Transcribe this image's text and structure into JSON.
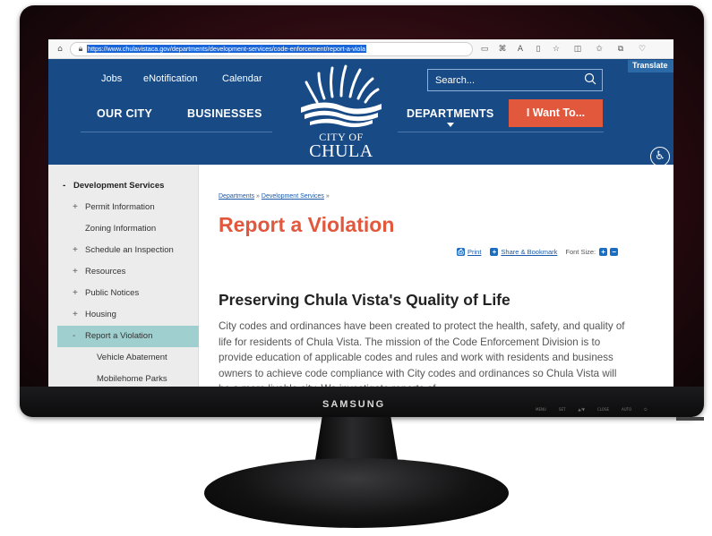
{
  "monitor": {
    "brand": "SAMSUNG",
    "controls": [
      "MENU",
      "SET",
      "▲/▼",
      "CLOSE",
      "AUTO",
      "⏻"
    ]
  },
  "browser": {
    "url": "https://www.chulavistaca.gov/departments/development-services/code-enforcement/report-a-viola"
  },
  "header": {
    "utility_links": [
      "Jobs",
      "eNotification",
      "Calendar"
    ],
    "search_placeholder": "Search...",
    "translate": "Translate",
    "nav": [
      "OUR CITY",
      "BUSINESSES",
      "DEPARTMENTS"
    ],
    "cta": "I Want To...",
    "logo_city": "CITY OF",
    "logo_name": "CHULA VISTA"
  },
  "sidebar": {
    "items": [
      {
        "sign": "-",
        "label": "Development Services"
      },
      {
        "sign": "+",
        "label": "Permit Information"
      },
      {
        "sign": "",
        "label": "Zoning Information"
      },
      {
        "sign": "+",
        "label": "Schedule an Inspection"
      },
      {
        "sign": "+",
        "label": "Resources"
      },
      {
        "sign": "+",
        "label": "Public Notices"
      },
      {
        "sign": "+",
        "label": "Housing"
      },
      {
        "sign": "-",
        "label": "Report a Violation"
      },
      {
        "sign": "",
        "label": "Vehicle Abatement"
      },
      {
        "sign": "",
        "label": "Mobilehome Parks"
      }
    ]
  },
  "main": {
    "breadcrumb": [
      "Departments",
      "Development Services"
    ],
    "breadcrumb_sep": "»",
    "title": "Report a Violation",
    "tools": {
      "print": "Print",
      "share": "Share & Bookmark",
      "font_size": "Font Size:"
    },
    "section_title": "Preserving Chula Vista's Quality of Life",
    "body": "City codes and ordinances have been created to protect the health, safety, and quality of life for residents of Chula Vista. The mission of the Code Enforcement Division is to provide education of applicable codes and rules and work with residents and business owners to achieve code compliance with City codes and ordinances so Chula Vista will be a more livable city. We investigate reports of"
  },
  "colors": {
    "header_bg": "#184a86",
    "accent": "#e2583c",
    "sidebar_active": "#9fcfcf",
    "link": "#1a5aa8"
  }
}
